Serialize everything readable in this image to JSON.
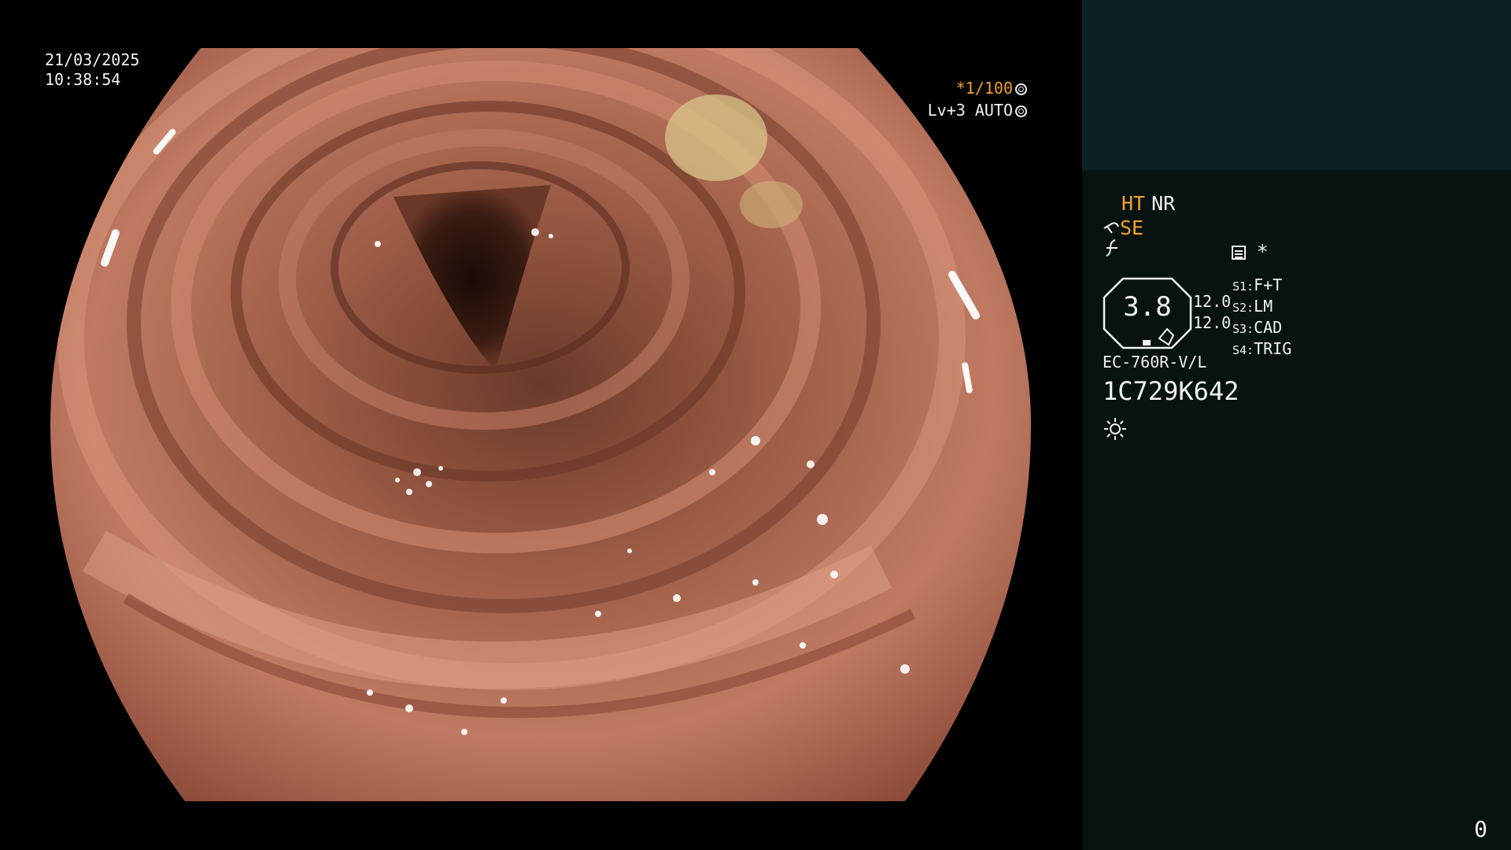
{
  "overlay": {
    "date": "21/03/2025",
    "time": "10:38:54",
    "shutter": "*1/100",
    "level": "Lv+3 AUTO"
  },
  "status": {
    "mode_ht": "HT",
    "mode_nr": "NR",
    "se_label": "SE",
    "asterisk": "*",
    "gauge_value": "3.8",
    "gauge_val_1": "12.0",
    "gauge_val_2": "12.0",
    "presets": [
      {
        "key": "S1:",
        "value": "F+T"
      },
      {
        "key": "S2:",
        "value": "LM"
      },
      {
        "key": "S3:",
        "value": "CAD"
      },
      {
        "key": "S4:",
        "value": "TRIG"
      }
    ],
    "scope_model": "EC-760R-V/L",
    "serial": "1C729K642",
    "counter": "0"
  },
  "colors": {
    "accent_amber": "#f0a32a",
    "panel_top": "#0c2222",
    "panel_bottom": "#061311",
    "tissue": "#b8705c"
  },
  "icons": [
    "shutter-ring-icon",
    "auto-ring-icon",
    "se-pen-icon",
    "edge-enhance-icon",
    "memory-box-icon",
    "light-sun-icon"
  ]
}
